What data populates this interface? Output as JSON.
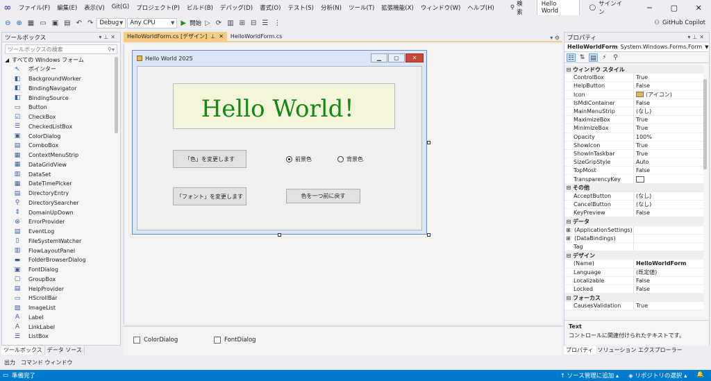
{
  "menubar": {
    "items": [
      "ファイル(F)",
      "編集(E)",
      "表示(V)",
      "Git(G)",
      "プロジェクト(P)",
      "ビルド(B)",
      "デバッグ(D)",
      "書式(O)",
      "テスト(S)",
      "分析(N)",
      "ツール(T)",
      "拡張機能(X)",
      "ウィンドウ(W)",
      "ヘルプ(H)"
    ],
    "search_label": "検索",
    "solution_name": "Hello World",
    "signin_label": "サインイン"
  },
  "toolbar": {
    "config": "Debug",
    "platform": "Any CPU",
    "start_label": "開始",
    "copilot_label": "GitHub Copilot"
  },
  "toolbox": {
    "title": "ツールボックス",
    "search_placeholder": "ツールボックスの検索",
    "category": "すべての Windows フォーム",
    "items": [
      {
        "label": "ポインター",
        "icon": "pointer-icon"
      },
      {
        "label": "BackgroundWorker",
        "icon": "component-icon"
      },
      {
        "label": "BindingNavigator",
        "icon": "component-icon"
      },
      {
        "label": "BindingSource",
        "icon": "component-icon"
      },
      {
        "label": "Button",
        "icon": "button-icon"
      },
      {
        "label": "CheckBox",
        "icon": "checkbox-icon"
      },
      {
        "label": "CheckedListBox",
        "icon": "list-icon"
      },
      {
        "label": "ColorDialog",
        "icon": "dialog-icon"
      },
      {
        "label": "ComboBox",
        "icon": "combobox-icon"
      },
      {
        "label": "ContextMenuStrip",
        "icon": "menu-icon"
      },
      {
        "label": "DataGridView",
        "icon": "grid-icon"
      },
      {
        "label": "DataSet",
        "icon": "dataset-icon"
      },
      {
        "label": "DateTimePicker",
        "icon": "calendar-icon"
      },
      {
        "label": "DirectoryEntry",
        "icon": "directory-icon"
      },
      {
        "label": "DirectorySearcher",
        "icon": "search-icon"
      },
      {
        "label": "DomainUpDown",
        "icon": "updown-icon"
      },
      {
        "label": "ErrorProvider",
        "icon": "error-icon"
      },
      {
        "label": "EventLog",
        "icon": "eventlog-icon"
      },
      {
        "label": "FileSystemWatcher",
        "icon": "file-icon"
      },
      {
        "label": "FlowLayoutPanel",
        "icon": "panel-icon"
      },
      {
        "label": "FolderBrowserDialog",
        "icon": "folder-icon"
      },
      {
        "label": "FontDialog",
        "icon": "dialog-icon"
      },
      {
        "label": "GroupBox",
        "icon": "groupbox-icon"
      },
      {
        "label": "HelpProvider",
        "icon": "help-icon"
      },
      {
        "label": "HScrollBar",
        "icon": "scrollbar-icon"
      },
      {
        "label": "ImageList",
        "icon": "image-icon"
      },
      {
        "label": "Label",
        "icon": "label-icon"
      },
      {
        "label": "LinkLabel",
        "icon": "link-icon"
      },
      {
        "label": "ListBox",
        "icon": "list-icon"
      }
    ],
    "tab_active": "ツールボックス",
    "tab_other": "データ ソース"
  },
  "bottom_tabs": [
    "出力",
    "コマンド ウィンドウ"
  ],
  "document": {
    "tab_active": "HelloWorldForm.cs [デザイン]",
    "tab_other": "HelloWorldForm.cs",
    "tray_items": [
      "ColorDialog",
      "FontDialog"
    ]
  },
  "form": {
    "title": "Hello World 2025",
    "hello_text": "Hello World！",
    "btn_color": "「色」を変更します",
    "btn_font": "「フォント」を変更します",
    "btn_revert": "色を一つ前に戻す",
    "radio_fore": "前景色",
    "radio_back": "背景色",
    "radio_fore_checked": true
  },
  "properties": {
    "title": "プロパティ",
    "object_name": "HelloWorldForm",
    "object_type": "System.Windows.Forms.Form",
    "rows": [
      {
        "kind": "cat",
        "name": "ウィンドウ スタイル"
      },
      {
        "kind": "row",
        "name": "ControlBox",
        "value": "True"
      },
      {
        "kind": "row",
        "name": "HelpButton",
        "value": "False"
      },
      {
        "kind": "row",
        "name": "Icon",
        "value": "(アイコン)",
        "swatch": "icon"
      },
      {
        "kind": "row",
        "name": "IsMdiContainer",
        "value": "False"
      },
      {
        "kind": "row",
        "name": "MainMenuStrip",
        "value": "(なし)"
      },
      {
        "kind": "row",
        "name": "MaximizeBox",
        "value": "True"
      },
      {
        "kind": "row",
        "name": "MinimizeBox",
        "value": "True"
      },
      {
        "kind": "row",
        "name": "Opacity",
        "value": "100%"
      },
      {
        "kind": "row",
        "name": "ShowIcon",
        "value": "True"
      },
      {
        "kind": "row",
        "name": "ShowInTaskbar",
        "value": "True"
      },
      {
        "kind": "row",
        "name": "SizeGripStyle",
        "value": "Auto"
      },
      {
        "kind": "row",
        "name": "TopMost",
        "value": "False"
      },
      {
        "kind": "row",
        "name": "TransparencyKey",
        "value": "",
        "swatch": "empty"
      },
      {
        "kind": "cat",
        "name": "その他"
      },
      {
        "kind": "row",
        "name": "AcceptButton",
        "value": "(なし)"
      },
      {
        "kind": "row",
        "name": "CancelButton",
        "value": "(なし)"
      },
      {
        "kind": "row",
        "name": "KeyPreview",
        "value": "False"
      },
      {
        "kind": "cat",
        "name": "データ"
      },
      {
        "kind": "row",
        "name": "(ApplicationSettings)",
        "value": "",
        "expand": true
      },
      {
        "kind": "row",
        "name": "(DataBindings)",
        "value": "",
        "expand": true
      },
      {
        "kind": "row",
        "name": "Tag",
        "value": ""
      },
      {
        "kind": "cat",
        "name": "デザイン"
      },
      {
        "kind": "row",
        "name": "(Name)",
        "value": "HelloWorldForm",
        "bold": true
      },
      {
        "kind": "row",
        "name": "Language",
        "value": "(既定値)"
      },
      {
        "kind": "row",
        "name": "Localizable",
        "value": "False"
      },
      {
        "kind": "row",
        "name": "Locked",
        "value": "False"
      },
      {
        "kind": "cat",
        "name": "フォーカス"
      },
      {
        "kind": "row",
        "name": "CausesValidation",
        "value": "True"
      }
    ],
    "desc_title": "Text",
    "desc_text": "コントロールに関連付けられたテキストです。",
    "tab_active": "プロパティ",
    "tab_other": "ソリューション エクスプローラー"
  },
  "statusbar": {
    "left": "準備完了",
    "source_control": "ソース管理に追加",
    "repo": "リポジトリの選択"
  },
  "colors": {
    "accent": "#007acc",
    "tab_active": "#f5cc84",
    "hello_text": "#108a10",
    "hello_bg": "#f5f5dc"
  }
}
